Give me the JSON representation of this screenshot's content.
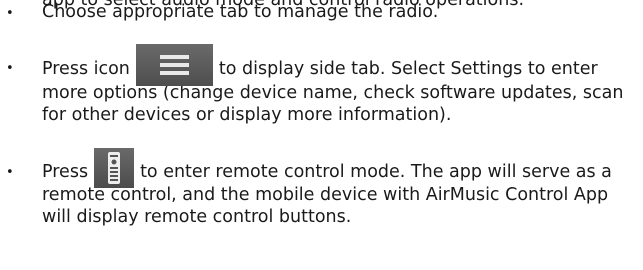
{
  "partial_top_line": "app to select audio mode and control radio operations.",
  "items": [
    {
      "bullet": "•",
      "text": "Choose appropriate tab to manage the radio."
    },
    {
      "bullet": "•",
      "before": "Press icon",
      "icon": "menu-icon",
      "after": "to display side tab. Select Settings to enter more options (change device name, check software updates, scan for other devices or display more information)."
    },
    {
      "bullet": "•",
      "before": "Press",
      "icon": "remote-control-icon",
      "after": "to enter remote control mode. The app will serve as a remote control, and the mobile device with AirMusic Control App will display remote control buttons."
    }
  ]
}
